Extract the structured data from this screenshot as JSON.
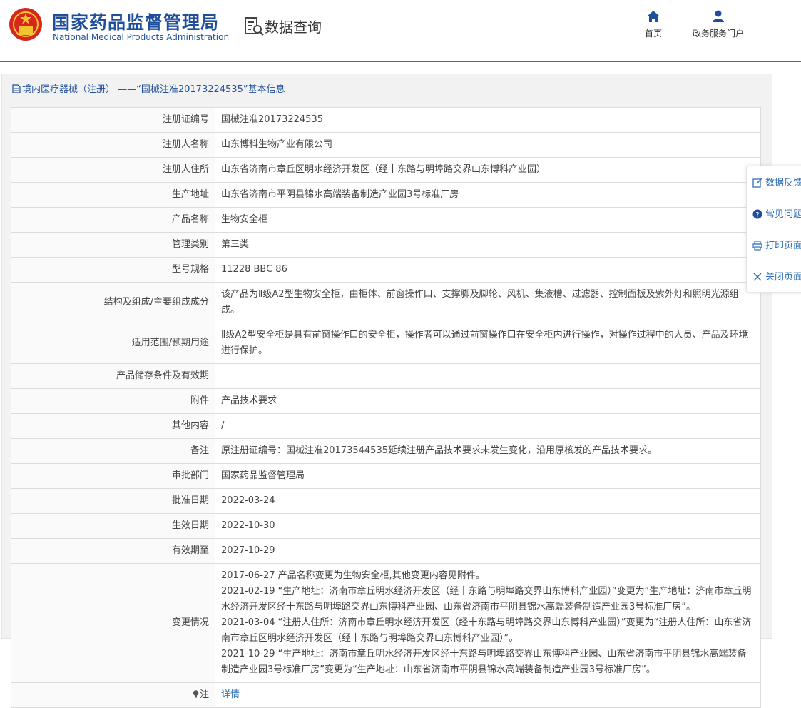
{
  "header": {
    "brand_cn": "国家药品监督管理局",
    "brand_en": "National Medical Products Administration",
    "section": "数据查询",
    "nav": [
      {
        "label": "首页",
        "icon": "home-icon"
      },
      {
        "label": "政务服务门户",
        "icon": "user-icon"
      }
    ]
  },
  "panel": {
    "title": "境内医疗器械（注册） ——“国械注准20173224535”基本信息"
  },
  "table": {
    "rows": [
      {
        "key": "注册证编号",
        "value": "国械注准20173224535"
      },
      {
        "key": "注册人名称",
        "value": "山东博科生物产业有限公司"
      },
      {
        "key": "注册人住所",
        "value": "山东省济南市章丘区明水经济开发区（经十东路与明埠路交界山东博科产业园）"
      },
      {
        "key": "生产地址",
        "value": "山东省济南市平阴县锦水高端装备制造产业园3号标准厂房"
      },
      {
        "key": "产品名称",
        "value": "生物安全柜"
      },
      {
        "key": "管理类别",
        "value": "第三类"
      },
      {
        "key": "型号规格",
        "value": "11228 BBC 86"
      },
      {
        "key": "结构及组成/主要组成成分",
        "value": "该产品为Ⅱ级A2型生物安全柜，由柜体、前窗操作口、支撑脚及脚轮、风机、集液槽、过滤器、控制面板及紫外灯和照明光源组成。"
      },
      {
        "key": "适用范围/预期用途",
        "value": "Ⅱ级A2型安全柜是具有前窗操作口的安全柜，操作者可以通过前窗操作口在安全柜内进行操作，对操作过程中的人员、产品及环境进行保护。"
      },
      {
        "key": "产品储存条件及有效期",
        "value": ""
      },
      {
        "key": "附件",
        "value": "产品技术要求"
      },
      {
        "key": "其他内容",
        "value": "/"
      },
      {
        "key": "备注",
        "value": "原注册证编号：国械注准20173544535延续注册产品技术要求未发生变化，沿用原核发的产品技术要求。"
      },
      {
        "key": "审批部门",
        "value": "国家药品监督管理局"
      },
      {
        "key": "批准日期",
        "value": "2022-03-24"
      },
      {
        "key": "生效日期",
        "value": "2022-10-30"
      },
      {
        "key": "有效期至",
        "value": "2027-10-29"
      }
    ],
    "changes_key": "变更情况",
    "changes": [
      "2017-06-27 产品名称变更为生物安全柜,其他变更内容见附件。",
      "2021-02-19 “生产地址：济南市章丘明水经济开发区（经十东路与明埠路交界山东博科产业园）”变更为“生产地址：济南市章丘明水经济开发区经十东路与明埠路交界山东博科产业园、山东省济南市平阴县锦水高端装备制造产业园3号标准厂房”。",
      "2021-03-04 “注册人住所：济南市章丘明水经济开发区（经十东路与明埠路交界山东博科产业园）”变更为“注册人住所：山东省济南市章丘区明水经济开发区（经十东路与明埠路交界山东博科产业园）”。",
      "2021-10-29 “生产地址：济南市章丘明水经济开发区经十东路与明埠路交界山东博科产业园、山东省济南市平阴县锦水高端装备制造产业园3号标准厂房”变更为“生产地址：山东省济南市平阴县锦水高端装备制造产业园3号标准厂房”。"
    ],
    "note_key": "注",
    "note_link": "详情"
  },
  "side": [
    {
      "label": "数据反馈",
      "icon": "edit-icon"
    },
    {
      "label": "常见问题",
      "icon": "question-icon"
    },
    {
      "label": "打印页面",
      "icon": "print-icon"
    },
    {
      "label": "关闭页面",
      "icon": "close-icon"
    }
  ]
}
